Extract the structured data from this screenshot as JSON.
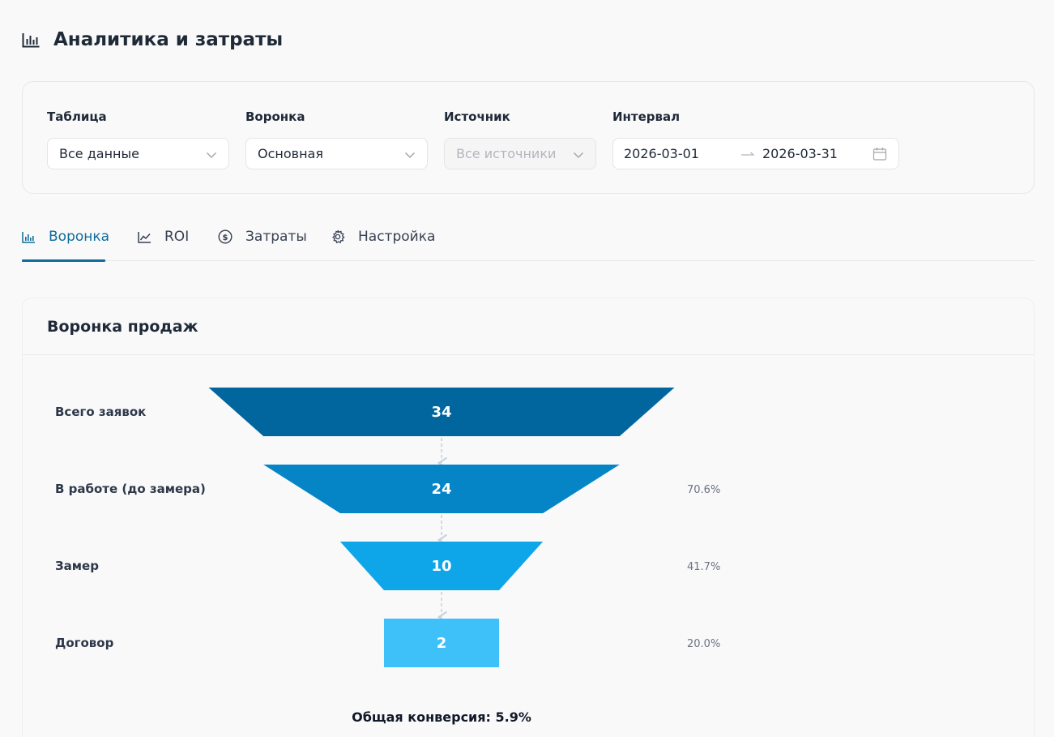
{
  "page": {
    "title": "Аналитика и затраты",
    "icon": "bar-chart-icon"
  },
  "filters": {
    "table": {
      "label": "Таблица",
      "value": "Все данные"
    },
    "funnel": {
      "label": "Воронка",
      "value": "Основная"
    },
    "source": {
      "label": "Источник",
      "placeholder": "Все источники",
      "disabled": true
    },
    "interval": {
      "label": "Интервал",
      "start": "2026-03-01",
      "end": "2026-03-31",
      "icon": "calendar-icon"
    }
  },
  "tabs": [
    {
      "label": "Воронка",
      "icon": "bar-chart-icon",
      "active": true
    },
    {
      "label": "ROI",
      "icon": "line-chart-icon",
      "active": false
    },
    {
      "label": "Затраты",
      "icon": "dollar-circle-icon",
      "active": false
    },
    {
      "label": "Настройка",
      "icon": "gear-icon",
      "active": false
    }
  ],
  "funnel_card": {
    "title": "Воронка продаж"
  },
  "chart_data": {
    "type": "funnel",
    "stages": [
      {
        "label": "Всего заявок",
        "value": 34,
        "conversion": "",
        "color": "#02669e"
      },
      {
        "label": "В работе (до замера)",
        "value": 24,
        "conversion": "70.6%",
        "color": "#0585c6"
      },
      {
        "label": "Замер",
        "value": 10,
        "conversion": "41.7%",
        "color": "#0ea5e9"
      },
      {
        "label": "Договор",
        "value": 2,
        "conversion": "20.0%",
        "color": "#3ec0f9"
      }
    ],
    "total_conversion": "Общая конверсия: 5.9%"
  },
  "colors": {
    "accent": "#106c9a",
    "border": "#e5e7eb",
    "background": "#f9f9fa"
  }
}
